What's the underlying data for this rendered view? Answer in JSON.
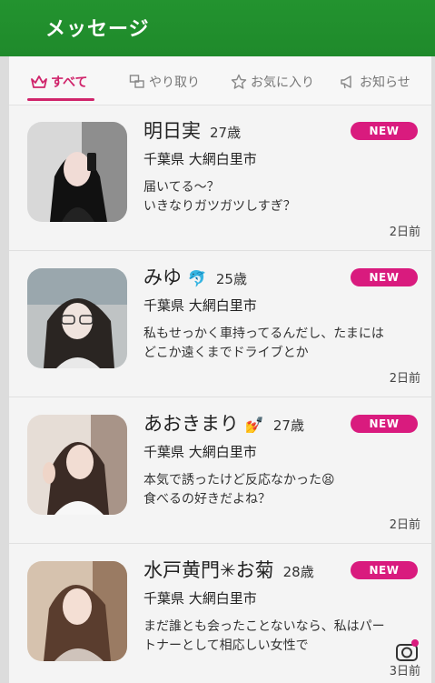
{
  "header": {
    "title": "メッセージ"
  },
  "tabs": [
    {
      "label": "すべて",
      "icon": "crown-icon",
      "active": true
    },
    {
      "label": "やり取り",
      "icon": "chat-icon",
      "active": false
    },
    {
      "label": "お気に入り",
      "icon": "star-icon",
      "active": false
    },
    {
      "label": "お知らせ",
      "icon": "megaphone-icon",
      "active": false
    }
  ],
  "messages": [
    {
      "name": "明日実",
      "age": "27歳",
      "location": "千葉県 大網白里市",
      "text": "届いてる～？\nいきなりガツガツしすぎ？",
      "badge": "NEW",
      "time": "2日前",
      "avatar_bg": "#3a3a3a"
    },
    {
      "name": "みゆ",
      "emoji": "🐬",
      "age": "25歳",
      "location": "千葉県 大網白里市",
      "text": "私もせっかく車持ってるんだし、たまにはどこか遠くまでドライブとか",
      "badge": "NEW",
      "time": "2日前",
      "avatar_bg": "#6f6d69"
    },
    {
      "name": "あおきまり",
      "emoji": "💅",
      "age": "27歳",
      "location": "千葉県 大網白里市",
      "text": "本気で誘ったけど反応なかった😫\n食べるの好きだよね？",
      "badge": "NEW",
      "time": "2日前",
      "avatar_bg": "#c8b3a7"
    },
    {
      "name": "水戸黄門✳お菊",
      "age": "28歳",
      "location": "千葉県 大網白里市",
      "text": "まだ誰とも会ったことないなら、私はパートナーとして相応しい女性で",
      "badge": "NEW",
      "time": "3日前",
      "avatar_bg": "#8a6a55"
    }
  ],
  "colors": {
    "header": "#1f8a2b",
    "accent": "#d91b7e"
  }
}
